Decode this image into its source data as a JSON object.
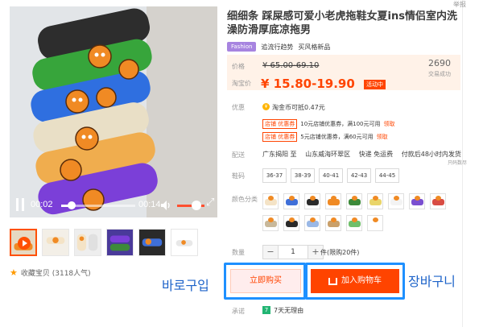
{
  "header_fade": "举报",
  "product": {
    "title": "细细条 踩屎感可爱小老虎拖鞋女夏ins情侣室内洗澡防滑厚底凉拖男",
    "fashion_badge": "Fashion",
    "tag_trend": "追流行趋势",
    "tag_new": "买风格新品"
  },
  "price": {
    "label_price": "价格",
    "original": "¥ 65.00-69.10",
    "label_taobao": "淘宝价",
    "sale": "¥ 15.80-19.90",
    "event_badge": "活动中",
    "sales_count": "2690",
    "sales_label": "交易成功"
  },
  "promo": {
    "label": "优惠",
    "coin_text": "淘金币可抵0.47元",
    "coupon_tag": "店铺 优惠券",
    "coupon1": "10元店铺优惠券，满100元可用",
    "coupon2": "5元店铺优惠券，满60元可用",
    "claim": "领取"
  },
  "shipping": {
    "label": "配送",
    "origin": "广东揭阳 至",
    "destination": "山东威海环翠区",
    "method": "快递 免运费",
    "guarantee": "付款后48小时内发货",
    "extra": "只码数尽"
  },
  "sizes": {
    "label": "鞋码",
    "options": [
      "36-37",
      "38-39",
      "40-41",
      "42-43",
      "44-45"
    ]
  },
  "colors": {
    "label": "颜色分类",
    "swatches": [
      "#f4e3c6",
      "#3f6fd8",
      "#2b2b2b",
      "#f08a24",
      "#3d8a3a",
      "#e9d56a",
      "#f3f3f3",
      "#7a4fd0",
      "#d84c44",
      "#c8b89a",
      "#2a2a2a",
      "#9ab8e6",
      "#c9a06a",
      "#6fbf6a",
      "#ffffff"
    ]
  },
  "quantity": {
    "label": "数量",
    "value": "1",
    "minus": "−",
    "plus": "+",
    "limit": "件(限购20件)"
  },
  "actions": {
    "buy_now": "立即购买",
    "add_to_cart": "加入购物车",
    "annotation_buy": "바로구입",
    "annotation_cart": "장바구니"
  },
  "promise": {
    "label": "承诺",
    "icon_text": "7",
    "text": "7天无理由"
  },
  "player": {
    "current_time": "00:02",
    "duration": "00:14",
    "progress": 0.14,
    "volume": 0.6
  },
  "favorite": {
    "text": "收藏宝贝 (3118人气)"
  },
  "thumbnails": [
    "video",
    "photo-2",
    "photo-3",
    "photo-4",
    "photo-5",
    "photo-6"
  ]
}
